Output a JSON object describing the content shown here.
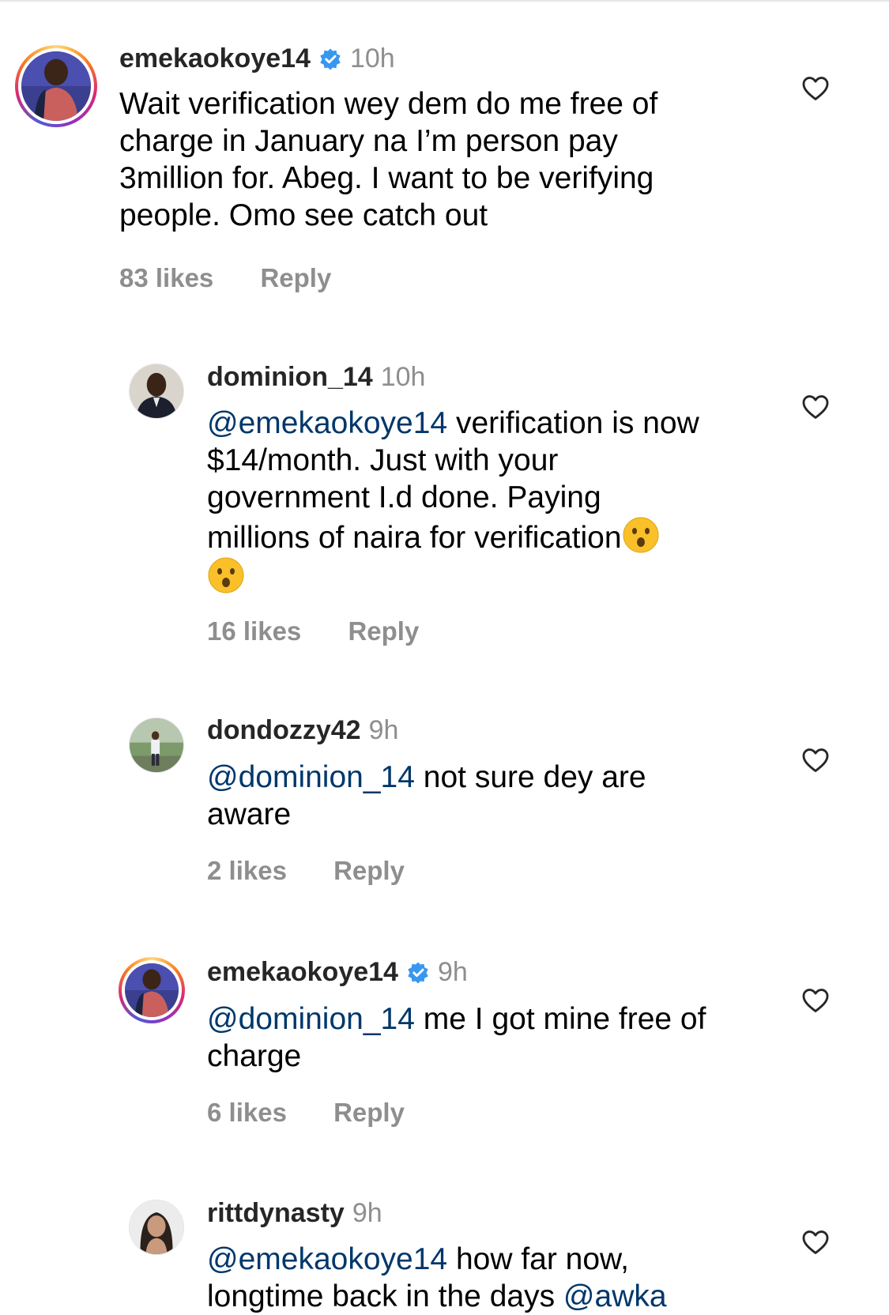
{
  "comments": [
    {
      "username": "emekaokoye14",
      "verified": true,
      "time": "10h",
      "text_lines": [
        "Wait verification wey dem do me free of",
        "charge in January na I’m person pay",
        "3million for. Abeg. I want to be verifying",
        "people.  Omo see catch out"
      ],
      "likes": "83 likes",
      "reply": "Reply"
    },
    {
      "username": "dominion_14",
      "verified": false,
      "time": "10h",
      "mention": "@emekaokoye14",
      "text_lines": [
        " verification is now",
        "$14/month. Just with your",
        "government I.d done. Paying",
        "millions of naira for verification"
      ],
      "likes": "16 likes",
      "reply": "Reply"
    },
    {
      "username": "dondozzy42",
      "verified": false,
      "time": "9h",
      "mention": "@dominion_14",
      "text_lines": [
        " not sure dey are",
        "aware"
      ],
      "likes": "2 likes",
      "reply": "Reply"
    },
    {
      "username": "emekaokoye14",
      "verified": true,
      "time": "9h",
      "mention": "@dominion_14",
      "text_lines": [
        " me I got mine free of",
        "charge"
      ],
      "likes": "6 likes",
      "reply": "Reply"
    },
    {
      "username": "rittdynasty",
      "verified": false,
      "time": "9h",
      "mention": "@emekaokoye14",
      "mention2": "@awka",
      "text_lines": [
        " how far now,",
        "longtime back in the days "
      ]
    }
  ],
  "icons": {
    "heart": "heart-outline-icon",
    "verified": "verified-badge-icon",
    "emoji": "hushed-face-emoji"
  },
  "colors": {
    "mention": "#00376b",
    "verified": "#3897f0",
    "meta": "#8e8e8e"
  }
}
